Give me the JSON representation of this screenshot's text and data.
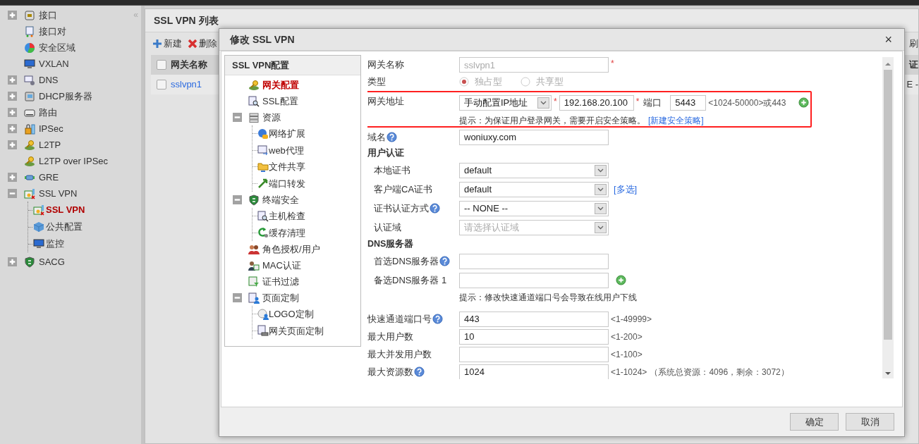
{
  "sidebar": {
    "collapse": "«",
    "items": [
      {
        "label": "接口",
        "expanded": false,
        "selected": false
      },
      {
        "label": "接口对",
        "selected": false
      },
      {
        "label": "安全区域",
        "selected": false
      },
      {
        "label": "VXLAN",
        "selected": false
      },
      {
        "label": "DNS",
        "expanded": false,
        "selected": false
      },
      {
        "label": "DHCP服务器",
        "expanded": false,
        "selected": false
      },
      {
        "label": "路由",
        "expanded": false,
        "selected": false
      },
      {
        "label": "IPSec",
        "expanded": false,
        "selected": false
      },
      {
        "label": "L2TP",
        "expanded": false,
        "selected": false
      },
      {
        "label": "L2TP over IPSec",
        "selected": false
      },
      {
        "label": "GRE",
        "expanded": false,
        "selected": false
      },
      {
        "label": "SSL VPN",
        "expanded": true,
        "selected": false,
        "children": [
          {
            "label": "SSL VPN",
            "selected": true
          },
          {
            "label": "公共配置",
            "selected": false
          },
          {
            "label": "监控",
            "selected": false
          }
        ]
      },
      {
        "label": "SACG",
        "expanded": false,
        "selected": false
      }
    ]
  },
  "list": {
    "title": "SSL VPN 列表",
    "toolbar": [
      {
        "kind": "add",
        "label": "新建"
      },
      {
        "kind": "delete",
        "label": "删除"
      }
    ],
    "toolbar_extra": "刷",
    "columns": [
      "网关名称",
      "证"
    ],
    "header_checked": false,
    "rows": [
      {
        "checked": false,
        "cells": [
          "sslvpn1",
          "E -"
        ]
      }
    ]
  },
  "dialog": {
    "title": "修改 SSL VPN",
    "close": "×",
    "tree": {
      "title": "SSL VPN配置",
      "items": [
        {
          "label": "网关配置",
          "selected": true
        },
        {
          "label": "SSL配置",
          "selected": false
        },
        {
          "label": "资源",
          "expanded": true,
          "selected": false,
          "children": [
            {
              "label": "网络扩展",
              "selected": false
            },
            {
              "label": "web代理",
              "selected": false
            },
            {
              "label": "文件共享",
              "selected": false
            },
            {
              "label": "端口转发",
              "selected": false
            }
          ]
        },
        {
          "label": "终端安全",
          "expanded": true,
          "selected": false,
          "children": [
            {
              "label": "主机检查",
              "selected": false
            },
            {
              "label": "缓存清理",
              "selected": false
            }
          ]
        },
        {
          "label": "角色授权/用户",
          "selected": false
        },
        {
          "label": "MAC认证",
          "selected": false
        },
        {
          "label": "证书过滤",
          "selected": false
        },
        {
          "label": "页面定制",
          "expanded": true,
          "selected": false,
          "children": [
            {
              "label": "LOGO定制",
              "selected": false
            },
            {
              "label": "网关页面定制",
              "selected": false
            }
          ]
        }
      ]
    },
    "form": [
      {
        "kind": "input",
        "label": "网关名称",
        "value": "sslvpn1",
        "disabled": true,
        "mark": "*"
      },
      {
        "kind": "radio",
        "label": "类型",
        "options": [
          {
            "label": "独占型",
            "selected": true,
            "disabled": true
          },
          {
            "label": "共享型",
            "selected": false,
            "disabled": true
          }
        ]
      },
      {
        "kind": "address",
        "label": "网关地址",
        "highlighted": true,
        "mode": "手动配置IP地址",
        "mode_mark": "*",
        "ip": "192.168.20.100",
        "ip_mark": "*",
        "port_label": "端口",
        "port": "5443",
        "port_range": "<1024-50000>或443",
        "hint": "提示：为保证用户登录网关，需要开启安全策略。",
        "link": "[新建安全策略]"
      },
      {
        "kind": "input",
        "label": "域名",
        "help": true,
        "value": "woniuxy.com"
      },
      {
        "kind": "section",
        "label": "用户认证",
        "children": [
          {
            "kind": "select",
            "label": "本地证书",
            "value": "default"
          },
          {
            "kind": "select",
            "label": "客户端CA证书",
            "value": "default",
            "link": "[多选]"
          },
          {
            "kind": "select",
            "label": "证书认证方式",
            "help": true,
            "value": "-- NONE --"
          },
          {
            "kind": "select",
            "label": "认证域",
            "placeholder": "请选择认证域"
          }
        ]
      },
      {
        "kind": "section",
        "label": "DNS服务器",
        "children": [
          {
            "kind": "input",
            "label": "首选DNS服务器",
            "help": true
          },
          {
            "kind": "input",
            "label": "备选DNS服务器 1",
            "add": true
          }
        ]
      },
      {
        "kind": "hint",
        "text": "提示：修改快速通道端口号会导致在线用户下线"
      },
      {
        "kind": "input",
        "label": "快速通道端口号",
        "help": true,
        "value": "443",
        "range": "<1-49999>"
      },
      {
        "kind": "input",
        "label": "最大用户数",
        "value": "10",
        "range": "<1-200>"
      },
      {
        "kind": "input",
        "label": "最大并发用户数",
        "range": "<1-100>"
      },
      {
        "kind": "input",
        "label": "最大资源数",
        "help": true,
        "value": "1024",
        "range": "<1-1024>",
        "note": "（系统总资源：4096，剩余：3072）"
      }
    ],
    "buttons": [
      "确定",
      "取消"
    ]
  }
}
